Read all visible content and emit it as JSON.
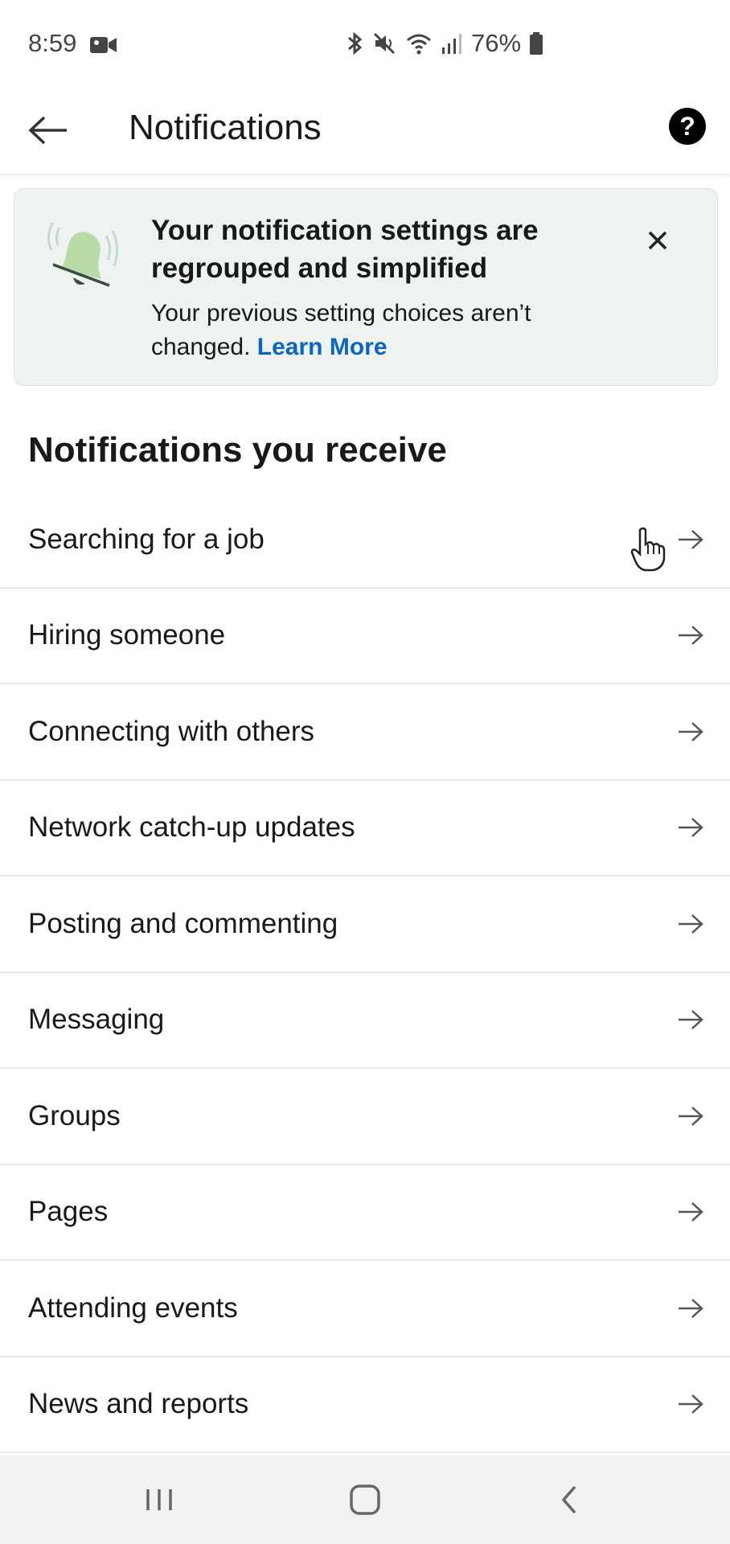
{
  "status_bar": {
    "time": "8:59",
    "battery": "76%",
    "icons": [
      "video-icon",
      "bluetooth-icon",
      "mute-icon",
      "wifi-icon",
      "signal-icon",
      "battery-icon"
    ]
  },
  "app_bar": {
    "title": "Notifications",
    "back_icon": "back-arrow-icon",
    "help_icon": "help-icon",
    "help_glyph": "?"
  },
  "banner": {
    "title": "Your notification settings are regrouped and simplified",
    "body": "Your previous setting choices aren’t changed.",
    "link": "Learn More",
    "icon": "bell-icon",
    "close_icon": "close-icon",
    "colors": {
      "background": "#eef3f1",
      "link": "#0a66c2",
      "bell": "#b9dba8"
    }
  },
  "section": {
    "heading": "Notifications you receive",
    "items": [
      {
        "label": "Searching for a job"
      },
      {
        "label": "Hiring someone"
      },
      {
        "label": "Connecting with others"
      },
      {
        "label": "Network catch-up updates"
      },
      {
        "label": "Posting and commenting"
      },
      {
        "label": "Messaging"
      },
      {
        "label": "Groups"
      },
      {
        "label": "Pages"
      },
      {
        "label": "Attending events"
      },
      {
        "label": "News and reports"
      }
    ]
  },
  "nav_bar": {
    "buttons": [
      "recent-apps-icon",
      "home-icon",
      "back-icon"
    ]
  }
}
